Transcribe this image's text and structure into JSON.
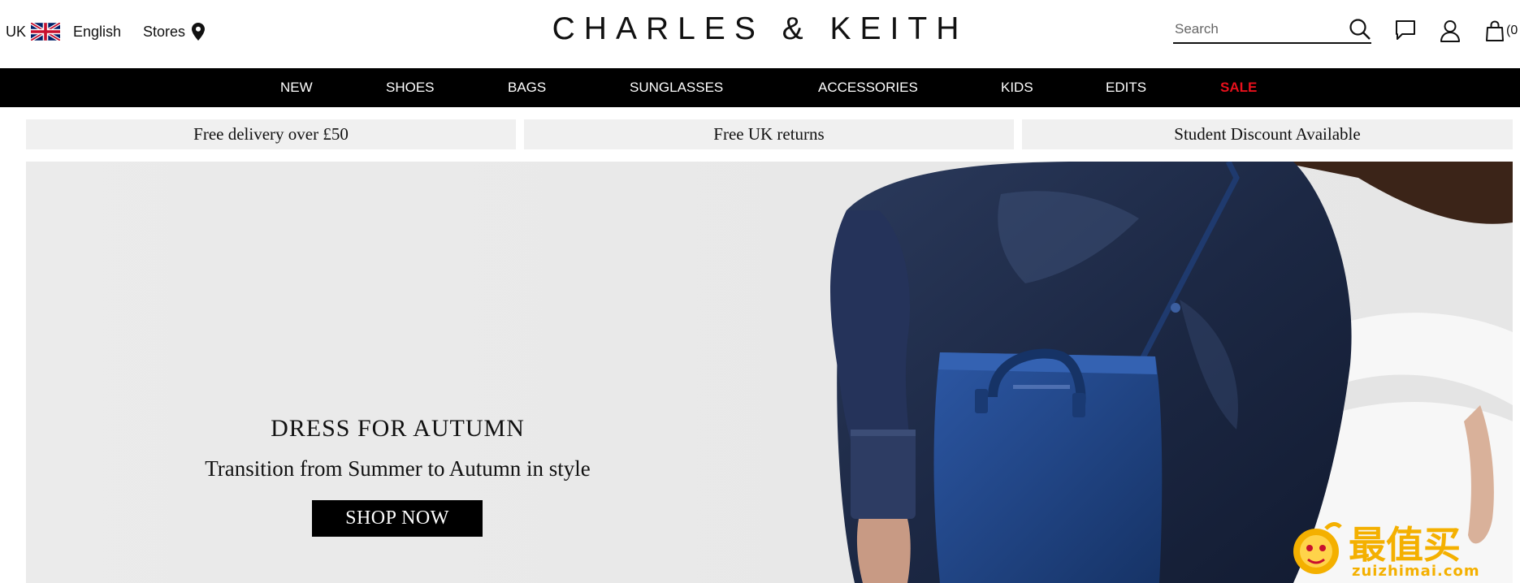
{
  "header": {
    "country": "UK",
    "language": "English",
    "stores_label": "Stores",
    "logo_text": "CHARLES & KEITH",
    "search_placeholder": "Search",
    "cart_count": "(0"
  },
  "nav": {
    "items": [
      "NEW",
      "SHOES",
      "BAGS",
      "SUNGLASSES",
      "ACCESSORIES",
      "KIDS",
      "EDITS",
      "SALE"
    ]
  },
  "promos": [
    "Free delivery over £50",
    "Free UK returns",
    "Student Discount Available"
  ],
  "hero": {
    "title": "DRESS FOR AUTUMN",
    "subtitle": "Transition from Summer to Autumn in style",
    "cta": "SHOP NOW"
  },
  "watermark": {
    "chinese": "最值买",
    "url": "zuizhimai.com"
  },
  "colors": {
    "nav_bg": "#000000",
    "sale": "#e8101c",
    "promo_bg": "#f0f0f0",
    "hero_bg": "#ebebeb",
    "shirt": "#1d2a45",
    "bag": "#1f3f7e"
  },
  "icons": [
    "uk-flag-icon",
    "map-pin-icon",
    "search-icon",
    "chat-icon",
    "account-icon",
    "bag-icon"
  ]
}
